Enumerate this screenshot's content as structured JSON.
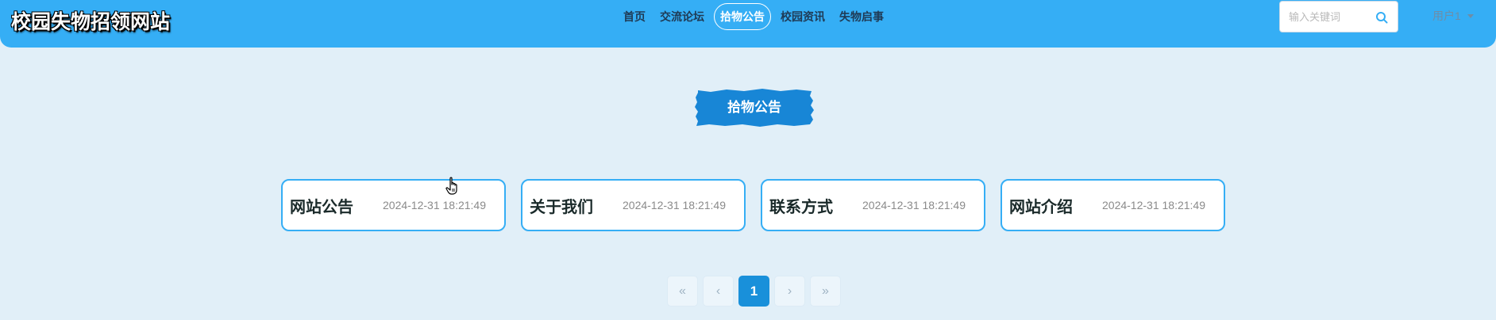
{
  "header": {
    "site_title": "校园失物招领网站",
    "nav": [
      {
        "label": "首页"
      },
      {
        "label": "交流论坛"
      },
      {
        "label": "拾物公告",
        "active": true
      },
      {
        "label": "校园资讯"
      },
      {
        "label": "失物启事"
      }
    ],
    "search": {
      "placeholder": "输入关键词",
      "value": "",
      "icon": "search-icon"
    },
    "user": {
      "label": "用户1",
      "icon": "caret-down-icon"
    }
  },
  "section": {
    "title": "拾物公告"
  },
  "cards": [
    {
      "title": "网站公告",
      "time": "2024-12-31 18:21:49"
    },
    {
      "title": "关于我们",
      "time": "2024-12-31 18:21:49"
    },
    {
      "title": "联系方式",
      "time": "2024-12-31 18:21:49"
    },
    {
      "title": "网站介绍",
      "time": "2024-12-31 18:21:49"
    }
  ],
  "pagination": {
    "first": "«",
    "prev": "‹",
    "current": "1",
    "next": "›",
    "last": "»"
  },
  "colors": {
    "header_bg": "#35aef5",
    "page_bg": "#e1eff8",
    "accent": "#1990da",
    "card_border": "#35aef5"
  }
}
